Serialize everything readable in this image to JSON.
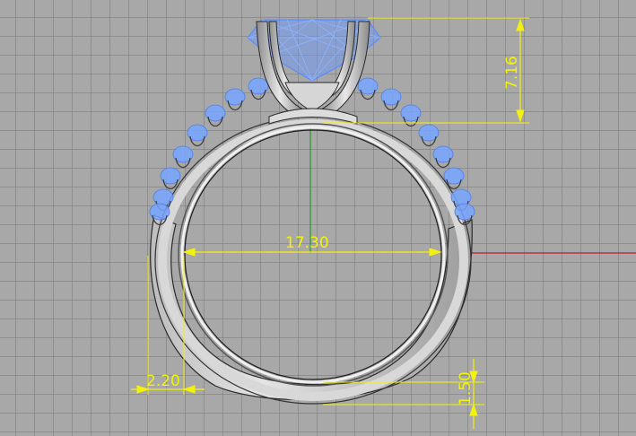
{
  "viewport": {
    "grid_color": "#7a7a7a",
    "background_color": "#a8a8a8",
    "x_axis_color": "#b80000",
    "y_axis_color": "#00a000",
    "dimension_color": "#f2f20a",
    "stone_wire_color": "#6fa0ff",
    "metal_color": "#cfcfcf"
  },
  "dimensions": {
    "head_height": "7.16",
    "inner_diameter": "17.30",
    "shank_width": "2.20",
    "shank_thickness": "1.50"
  }
}
